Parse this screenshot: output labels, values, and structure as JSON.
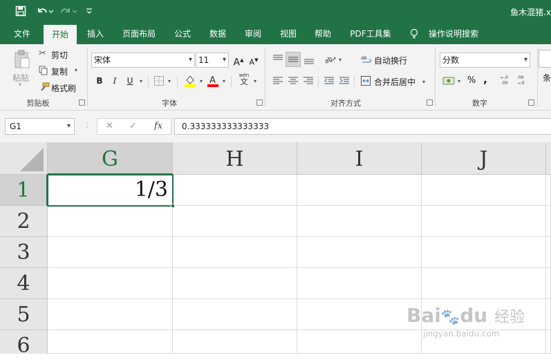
{
  "qat": {
    "save_icon": "save-icon",
    "undo_icon": "undo-icon",
    "redo_icon": "redo-icon",
    "customize_icon": "customize-qat-icon"
  },
  "title": "鱼木混猪.x",
  "tabs": [
    "文件",
    "开始",
    "插入",
    "页面布局",
    "公式",
    "数据",
    "审阅",
    "视图",
    "帮助",
    "PDF工具集"
  ],
  "tell_me": "操作说明搜索",
  "ribbon": {
    "clipboard": {
      "paste": "粘贴",
      "cut": "剪切",
      "copy": "复制",
      "format_painter": "格式刷",
      "label": "剪贴板"
    },
    "font": {
      "name": "宋体",
      "size": "11",
      "grow": "A",
      "shrink": "A",
      "bold": "B",
      "italic": "I",
      "underline": "U",
      "phonetic": "wén",
      "phonetic_sub": "文",
      "label": "字体"
    },
    "alignment": {
      "wrap": "自动换行",
      "merge": "合并后居中",
      "label": "对齐方式"
    },
    "number": {
      "format": "分数",
      "percent": "%",
      "comma": ",",
      "label": "数字"
    },
    "styles": {
      "partial": "条"
    }
  },
  "formula_bar": {
    "name_box": "G1",
    "cancel": "✕",
    "enter": "✓",
    "fx": "fx",
    "value": "0.333333333333333"
  },
  "sheet": {
    "columns": [
      "G",
      "H",
      "I",
      "J"
    ],
    "rows": [
      "1",
      "2",
      "3",
      "4",
      "5",
      "6"
    ],
    "selected_cell": "G1",
    "cell_G1": "1/3"
  },
  "watermark": {
    "brand": "Bai",
    "brand2": "du",
    "brand_cn": "经验",
    "url": "jingyan.baidu.com"
  },
  "colors": {
    "excel_green": "#217346",
    "ribbon_bg": "#f3f3f3",
    "header_bg": "#e6e6e6"
  }
}
